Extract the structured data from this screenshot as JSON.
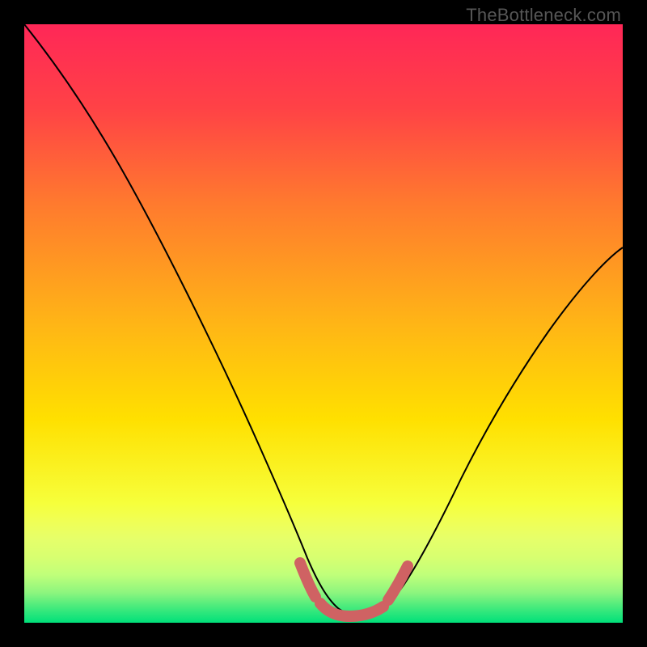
{
  "attribution": "TheBottleneck.com",
  "colors": {
    "frame_bg": "#000000",
    "gradient_top": "#ff2757",
    "gradient_mid1": "#ff7a2e",
    "gradient_mid2": "#ffd90a",
    "gradient_mid3": "#f6ff3b",
    "gradient_low": "#d8ff70",
    "gradient_bottom": "#00e07a",
    "curve": "#000000",
    "marker": "#cf6263"
  },
  "chart_data": {
    "type": "line",
    "title": "",
    "xlabel": "",
    "ylabel": "",
    "xlim": [
      0,
      100
    ],
    "ylim": [
      0,
      100
    ],
    "grid": false,
    "legend": false,
    "series": [
      {
        "name": "bottleneck-curve",
        "x": [
          0,
          5,
          10,
          15,
          20,
          25,
          30,
          35,
          40,
          45,
          48,
          50,
          52,
          55,
          58,
          62,
          68,
          75,
          82,
          90,
          100
        ],
        "values": [
          100,
          93,
          86,
          78,
          70,
          61,
          52,
          42,
          31,
          18,
          10,
          5,
          3,
          2,
          2,
          4,
          10,
          20,
          32,
          45,
          60
        ]
      }
    ],
    "annotations": [
      {
        "name": "optimal-range-marker",
        "x_start": 46,
        "x_end": 63,
        "note": "thick salmon stroke highlighting the trough"
      }
    ]
  }
}
